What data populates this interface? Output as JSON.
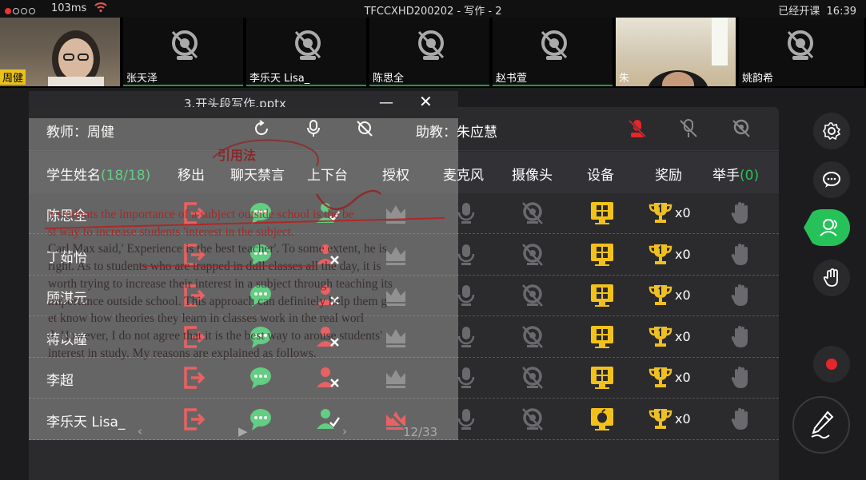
{
  "status_bar": {
    "latency": "103ms",
    "title": "TFCCXHD200202 - 写作 - 2",
    "class_status": "已经开课",
    "time": "16:39"
  },
  "video_tiles": [
    {
      "name": "周健",
      "state": "video",
      "icon": "person-video"
    },
    {
      "name": "张天泽",
      "state": "camera-off",
      "icon": "camera-off-icon"
    },
    {
      "name": "李乐天 Lisa_",
      "state": "camera-off",
      "icon": "camera-off-icon"
    },
    {
      "name": "陈思全",
      "state": "camera-off",
      "icon": "camera-off-icon"
    },
    {
      "name": "赵书萱",
      "state": "camera-off",
      "icon": "camera-off-icon"
    },
    {
      "name": "朱",
      "state": "video",
      "icon": "person-video"
    },
    {
      "name": "姚韵希",
      "state": "camera-off",
      "icon": "camera-off-icon"
    }
  ],
  "slide": {
    "filename": "3.开头段写作.pptx",
    "minimize": "—",
    "close": "✕",
    "handwritten_title": "引用法",
    "lines": [
      "n students the importance of a subject outside school is the be",
      "st way to increase students 'interest in the subject.",
      "Carl Max said,' Experience is the best teacher'. To some extent, he is",
      "right. As to students who are trapped in dull classes all the day, it is",
      "worth trying to increase their interest in a subject through teaching its",
      " importance outside school. This approach can definitely help them g",
      "et know how theories they learn in classes work in the real worl",
      "d. However, I do not agree that it is the best way to arouse students'",
      "interest in study. My reasons are explained as follows."
    ],
    "page": "12/33"
  },
  "panel": {
    "teacher": "教师：周健",
    "assistant": "助教：朱应慧",
    "headers": {
      "student_name": "学生姓名",
      "student_count": "(18/18)",
      "remove": "移出",
      "chat_ban": "聊天禁言",
      "stage": "上下台",
      "authorize": "授权",
      "mic": "麦克风",
      "camera": "摄像头",
      "device": "设备",
      "reward": "奖励",
      "hand_raise": "举手",
      "hand_count": "(0)"
    },
    "students": [
      {
        "name": "陈思全",
        "reward": "x0",
        "stage_on": true,
        "authorized": false,
        "device": "windows"
      },
      {
        "name": "丁茹怡",
        "reward": "x0",
        "stage_on": false,
        "authorized": false,
        "device": "windows"
      },
      {
        "name": "顾淇元",
        "reward": "x0",
        "stage_on": false,
        "authorized": false,
        "device": "windows"
      },
      {
        "name": "蒋以瞳",
        "reward": "x0",
        "stage_on": false,
        "authorized": false,
        "device": "windows"
      },
      {
        "name": "李超",
        "reward": "x0",
        "stage_on": false,
        "authorized": false,
        "device": "windows"
      },
      {
        "name": "李乐天 Lisa_",
        "reward": "x0",
        "stage_on": true,
        "authorized": true,
        "device": "apple"
      }
    ]
  },
  "colors": {
    "accent_green": "#27c15a",
    "alert_red": "#e5262b",
    "device_yellow": "#f2c21b",
    "trophy_gold": "#f0c020"
  }
}
